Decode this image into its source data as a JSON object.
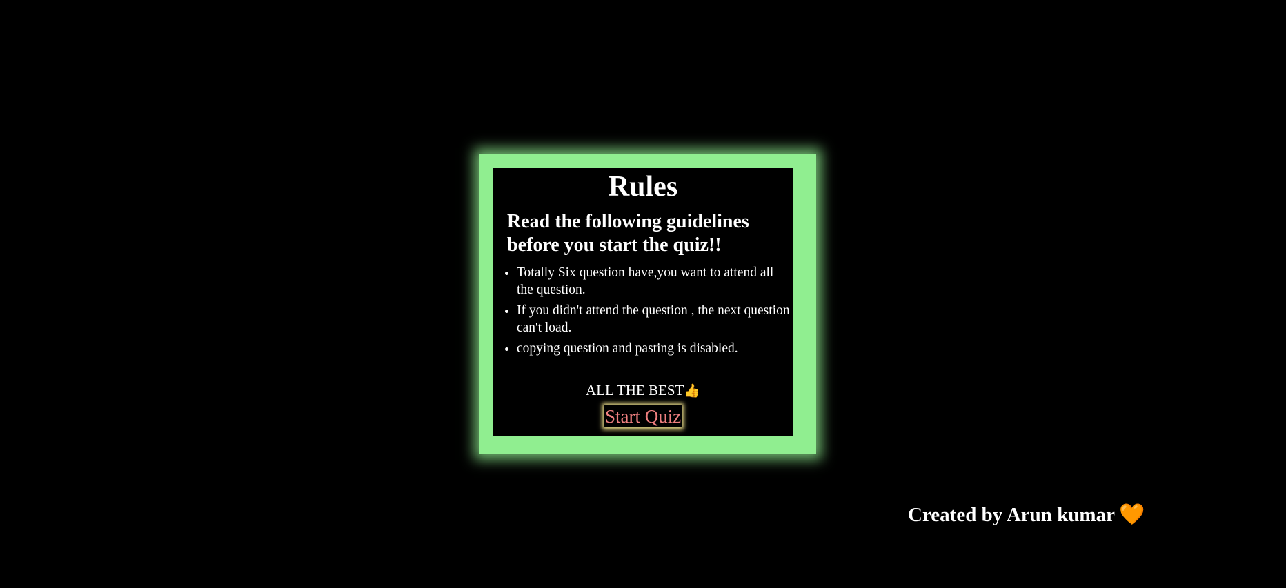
{
  "rules": {
    "title": "Rules",
    "subtitle": "Read the following guidelines before you start the quiz!!",
    "items": [
      "Totally Six question have,you want to attend all the question.",
      "If you didn't attend the question , the next question can't load.",
      "copying question and pasting is disabled."
    ],
    "best_message": "ALL THE BEST",
    "best_icon": "👍",
    "start_button": "Start Quiz"
  },
  "footer": {
    "credit": "Created by Arun kumar",
    "heart_icon": "🧡"
  },
  "colors": {
    "page_background": "#000000",
    "frame_glow": "#90ee90",
    "start_button_text": "#f08080",
    "heart": "#f26b3a"
  }
}
